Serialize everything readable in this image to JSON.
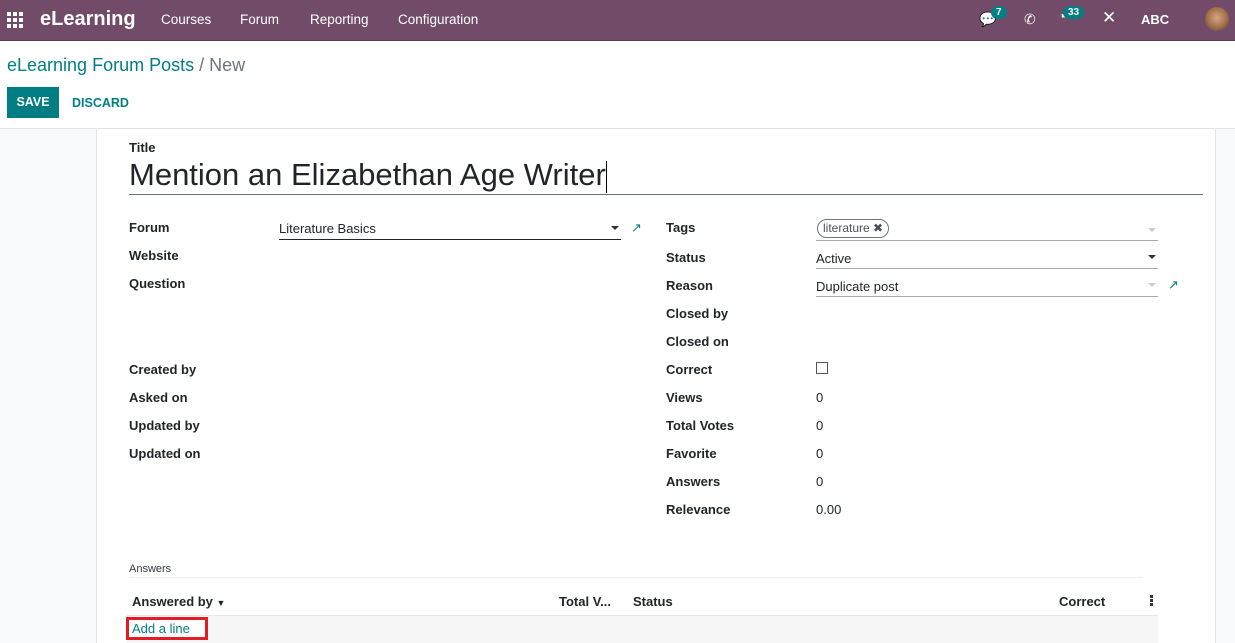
{
  "navbar": {
    "brand": "eLearning",
    "menu": [
      "Courses",
      "Forum",
      "Reporting",
      "Configuration"
    ],
    "messages_count": "7",
    "activities_count": "33",
    "company": "ABC",
    "accent": "#714B67"
  },
  "breadcrumb": {
    "parent": "eLearning Forum Posts",
    "separator": "/",
    "current": "New"
  },
  "actions": {
    "save": "SAVE",
    "discard": "DISCARD"
  },
  "form": {
    "title_label": "Title",
    "title_value": "Mention an Elizabethan Age Writer",
    "left": [
      {
        "label": "Forum",
        "value": "Literature Basics"
      },
      {
        "label": "Website",
        "value": ""
      },
      {
        "label": "Question",
        "value": ""
      },
      {
        "label": "Created by",
        "value": ""
      },
      {
        "label": "Asked on",
        "value": ""
      },
      {
        "label": "Updated by",
        "value": ""
      },
      {
        "label": "Updated on",
        "value": ""
      }
    ],
    "right": [
      {
        "label": "Tags",
        "value": "literature"
      },
      {
        "label": "Status",
        "value": "Active"
      },
      {
        "label": "Reason",
        "value": "Duplicate post"
      },
      {
        "label": "Closed by",
        "value": ""
      },
      {
        "label": "Closed on",
        "value": ""
      },
      {
        "label": "Correct",
        "value": false
      },
      {
        "label": "Views",
        "value": "0"
      },
      {
        "label": "Total Votes",
        "value": "0"
      },
      {
        "label": "Favorite",
        "value": "0"
      },
      {
        "label": "Answers",
        "value": "0"
      },
      {
        "label": "Relevance",
        "value": "0.00"
      }
    ]
  },
  "answers": {
    "label": "Answers",
    "columns": [
      "Answered by",
      "Total V...",
      "Status",
      "Correct"
    ],
    "add_line": "Add a line"
  }
}
